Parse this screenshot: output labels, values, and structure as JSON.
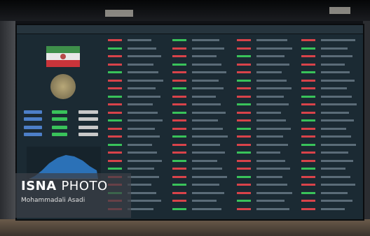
{
  "watermark": {
    "brand": "ISNA",
    "brand_suffix": "PHOTO",
    "photographer": "Mohammadali Asadi"
  },
  "scene": {
    "subject": "stock-exchange-display-board",
    "colors": {
      "board": "#1b2a33",
      "positive": "#39c25a",
      "negative": "#d8434a",
      "chart_fill": "#2f7fd0"
    }
  }
}
